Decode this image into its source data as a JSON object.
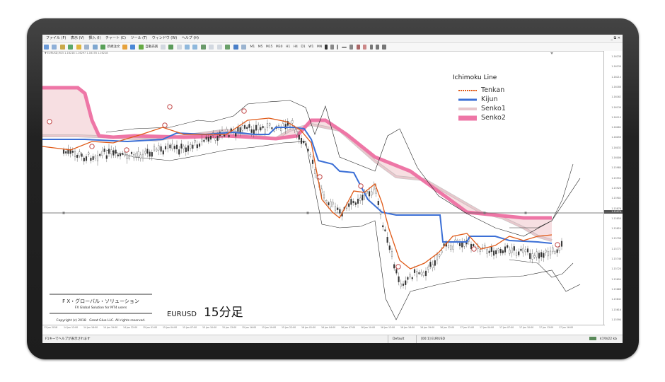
{
  "menu": {
    "items": [
      "ファイル (F)",
      "表示 (V)",
      "挿入 (I)",
      "チャート (C)",
      "ツール (T)",
      "ウィンドウ (W)",
      "ヘルプ (H)"
    ],
    "window_controls": "_ ⧉ ✕"
  },
  "toolbar": {
    "new_order_label": "新規注文",
    "auto_trade_label": "自動売買",
    "timeframes": [
      "M1",
      "M5",
      "M15",
      "M30",
      "H1",
      "H4",
      "D1",
      "W1",
      "MN"
    ]
  },
  "chart": {
    "info": "▼ EURUSD,M15 1.16218 1.16297 1.16178 1.16218",
    "price_labels": [
      "1.16238",
      "1.16230",
      "1.16214",
      "1.16188",
      "1.16162",
      "1.16136",
      "1.16110",
      "1.16084",
      "1.16058",
      "1.16032",
      "1.16006",
      "1.15980",
      "1.15954",
      "1.15928",
      "1.15902",
      "1.15876",
      "1.15850",
      "1.15824",
      "1.15798",
      "1.15772",
      "1.15746",
      "1.15720",
      "1.15694",
      "1.15668",
      "1.15642",
      "1.15616",
      "1.15590"
    ],
    "current_price": "1.15974",
    "time_labels": [
      "13 Jan 2018",
      "14 Jan 13:00",
      "14 Jan 16:00",
      "14 Jan 19:00",
      "14 Jan 22:00",
      "15 Jan 01:00",
      "15 Jan 04:00",
      "15 Jan 07:00",
      "15 Jan 10:00",
      "15 Jan 13:00",
      "15 Jan 16:00",
      "15 Jan 19:00",
      "15 Jan 22:00",
      "16 Jan 01:00",
      "16 Jan 04:00",
      "16 Jan 07:00",
      "16 Jan 10:00",
      "16 Jan 13:00",
      "16 Jan 16:00",
      "16 Jan 19:00",
      "16 Jan 22:00",
      "17 Jan 01:00",
      "17 Jan 04:00",
      "17 Jan 07:00",
      "17 Jan 10:00",
      "17 Jan 13:00",
      "17 Jan 16:00"
    ]
  },
  "legend": {
    "title": "Ichimoku Line",
    "items": [
      {
        "label": "Tenkan",
        "color": "#e05a18",
        "style": "dotted"
      },
      {
        "label": "Kijun",
        "color": "#3b6fd6",
        "style": "solid"
      },
      {
        "label": "Senko1",
        "color": "#e8c7cc",
        "style": "thick"
      },
      {
        "label": "Senko2",
        "color": "#ee76a6",
        "style": "thick"
      }
    ]
  },
  "promo": {
    "jp": "F X・グローバル・ソリューション",
    "en": "FX Global Solution for MT4 users",
    "copyright": "Copyright (c) 2018　Great Glue LLC.  All rights reserved."
  },
  "pair": {
    "symbol": "EURUSD",
    "timeframe": "15分足"
  },
  "status": {
    "help": "F1キーでヘルプが表示されます",
    "default": "Default",
    "info": "[00:1] EURUSD",
    "traffic": "47/0/22 kb"
  }
}
